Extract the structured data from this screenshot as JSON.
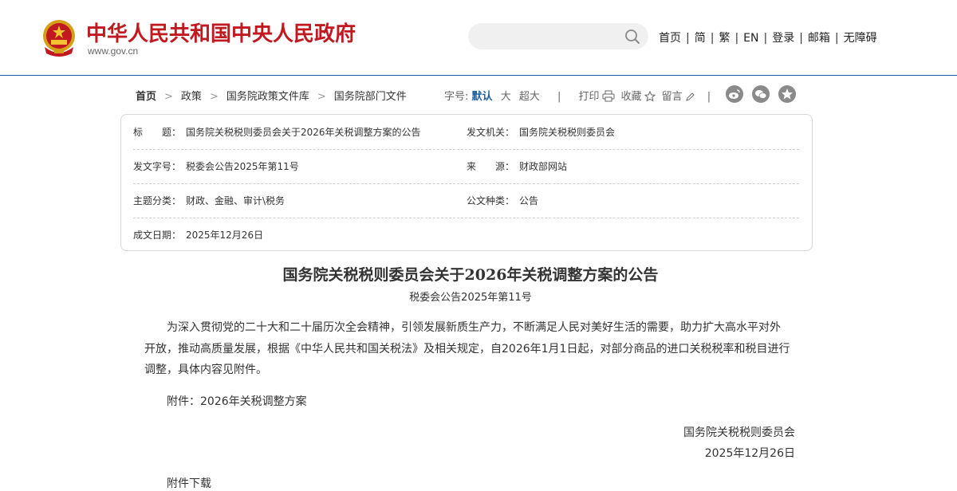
{
  "header": {
    "site_title": "中华人民共和国中央人民政府",
    "site_url": "www.gov.cn",
    "search": {
      "placeholder": ""
    },
    "nav": [
      "首页",
      "简",
      "繁",
      "EN",
      "登录",
      "邮箱",
      "无障碍"
    ],
    "nav_separator": "|"
  },
  "breadcrumb": {
    "items": [
      "首页",
      "政策",
      "国务院政策文件库",
      "国务院部门文件"
    ],
    "separator": ">"
  },
  "tools": {
    "font_size_label": "字号:",
    "size_default": "默认",
    "size_large": "大",
    "size_xlarge": "超大",
    "print": "打印",
    "favorite": "收藏",
    "comment": "留言",
    "separator": "|",
    "share_icons": [
      "weibo-icon",
      "wechat-icon",
      "qzone-icon"
    ]
  },
  "info": {
    "title_label": "标　　题：",
    "title_value": "国务院关税税则委员会关于2026年关税调整方案的公告",
    "issuer_label": "发文机关：",
    "issuer_value": "国务院关税税则委员会",
    "doc_no_label": "发文字号：",
    "doc_no_value": "税委会公告2025年第11号",
    "source_label": "来　　源：",
    "source_value": "财政部网站",
    "category_label": "主题分类：",
    "category_value": "财政、金融、审计\\税务",
    "type_label": "公文种类：",
    "type_value": "公告",
    "date_label": "成文日期：",
    "date_value": "2025年12月26日"
  },
  "article": {
    "title": "国务院关税税则委员会关于2026年关税调整方案的公告",
    "doc_no": "税委会公告2025年第11号",
    "body": "为深入贯彻党的二十大和二十届历次全会精神，引领发展新质生产力，不断满足人民对美好生活的需要，助力扩大高水平对外开放，推动高质量发展，根据《中华人民共和国关税法》及相关规定，自2026年1月1日起，对部分商品的进口关税税率和税目进行调整，具体内容见附件。",
    "attachment": "附件：2026年关税调整方案",
    "signer": "国务院关税税则委员会",
    "sign_date": "2025年12月26日",
    "download_label": "附件下载"
  },
  "colors": {
    "brand_red": "#c0191f",
    "accent_blue": "#1f5f9e",
    "divider": "#1f5f9e"
  }
}
